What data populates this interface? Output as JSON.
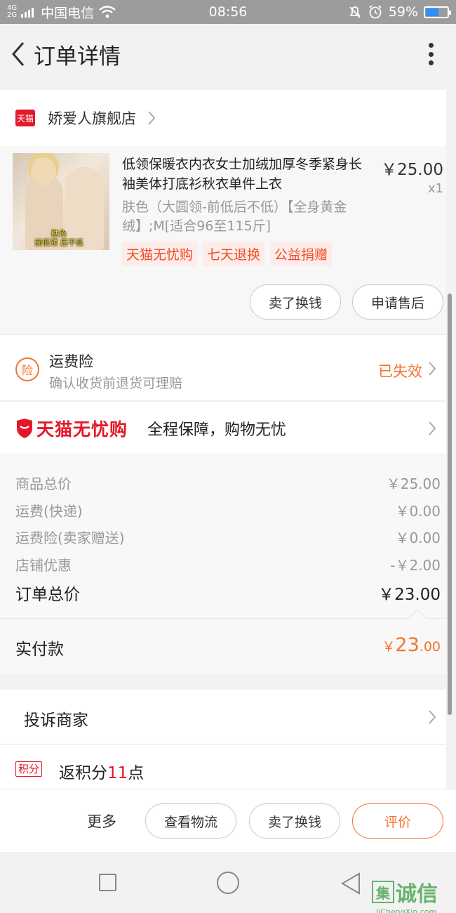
{
  "status_bar": {
    "network_top": "4G",
    "network_bottom": "2G",
    "carrier": "中国电信",
    "time": "08:56",
    "battery_text": "59%",
    "battery_level": 0.59
  },
  "nav": {
    "title": "订单详情"
  },
  "store": {
    "badge": "天猫",
    "name": "娇爱人旗舰店"
  },
  "product": {
    "title": "低领保暖衣内衣女士加绒加厚冬季紧身长袖美体打底衫秋衣单件上衣",
    "sku": "肤色（大圆领-前低后不低）【全身黄金绒】;M[适合96至115斤]",
    "price": "￥25.00",
    "quantity": "x1",
    "image_caption_line1": "肤色",
    "image_caption_line2": "前低领 后不低",
    "tags": [
      "天猫无忧购",
      "七天退换",
      "公益捐赠"
    ],
    "buttons": [
      "卖了换钱",
      "申请售后"
    ]
  },
  "insurance": {
    "icon_char": "险",
    "title": "运费险",
    "subtitle": "确认收货前退货可理赔",
    "status": "已失效"
  },
  "worry_free": {
    "logo": "天猫无忧购",
    "text": "全程保障，购物无忧"
  },
  "price_summary": {
    "lines": [
      {
        "label": "商品总价",
        "value": "￥25.00"
      },
      {
        "label": "运费(快递)",
        "value": "￥0.00"
      },
      {
        "label": "运费险(卖家赠送)",
        "value": "￥0.00"
      },
      {
        "label": "店铺优惠",
        "value": "-￥2.00"
      }
    ],
    "total_label": "订单总价",
    "total_value": "￥23.00"
  },
  "payment": {
    "label": "实付款",
    "symbol": "￥",
    "integer": "23",
    "decimal": ".00"
  },
  "complain": {
    "label": "投诉商家"
  },
  "points": {
    "badge": "积分",
    "prefix": "返积分",
    "count": "11",
    "suffix": "点"
  },
  "action_bar": {
    "more": "更多",
    "logistics": "查看物流",
    "resell": "卖了换钱",
    "review": "评价"
  },
  "watermark": {
    "logo_box": "集",
    "logo_text": "诚信",
    "url": "JiChengXin.com"
  },
  "colors": {
    "accent_orange": "#f5722e",
    "tmall_red": "#e4182a"
  }
}
